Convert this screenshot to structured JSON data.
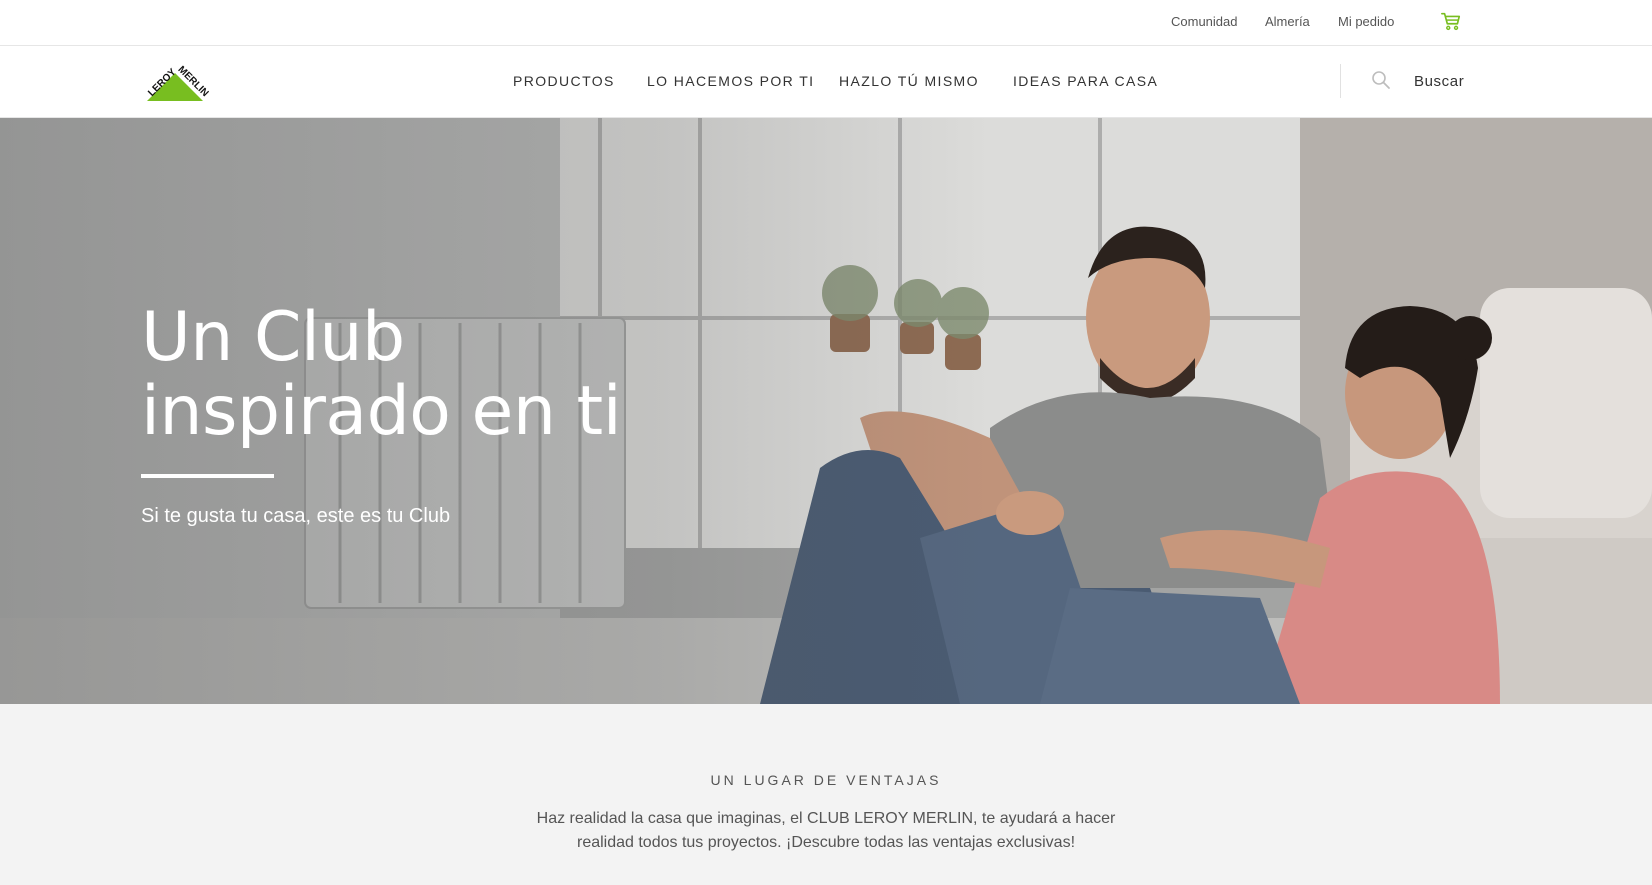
{
  "topbar": {
    "links": [
      {
        "label": "Comunidad"
      },
      {
        "label": "Almería"
      },
      {
        "label": "Mi pedido"
      }
    ],
    "cart_icon": "shopping-cart-icon",
    "cart_color": "#78be20"
  },
  "nav": {
    "logo_alt": "LEROY MERLIN",
    "items": [
      {
        "label": "PRODUCTOS"
      },
      {
        "label": "LO HACEMOS POR TI"
      },
      {
        "label": "HAZLO TÚ MISMO"
      },
      {
        "label": "IDEAS PARA CASA"
      }
    ],
    "search_icon": "search-icon",
    "search_label": "Buscar"
  },
  "hero": {
    "title_line1": "Un Club",
    "title_line2": "inspirado en ti",
    "subtitle": "Si te gusta tu casa, este es tu Club"
  },
  "benefits": {
    "eyebrow": "UN LUGAR DE VENTAJAS",
    "text": "Haz realidad la casa que imaginas, el CLUB LEROY MERLIN, te ayudará a hacer realidad todos tus proyectos. ¡Descubre todas las ventajas exclusivas!"
  },
  "colors": {
    "brand_green": "#78be20",
    "text_dark": "#333333",
    "section_bg": "#f3f3f3"
  }
}
